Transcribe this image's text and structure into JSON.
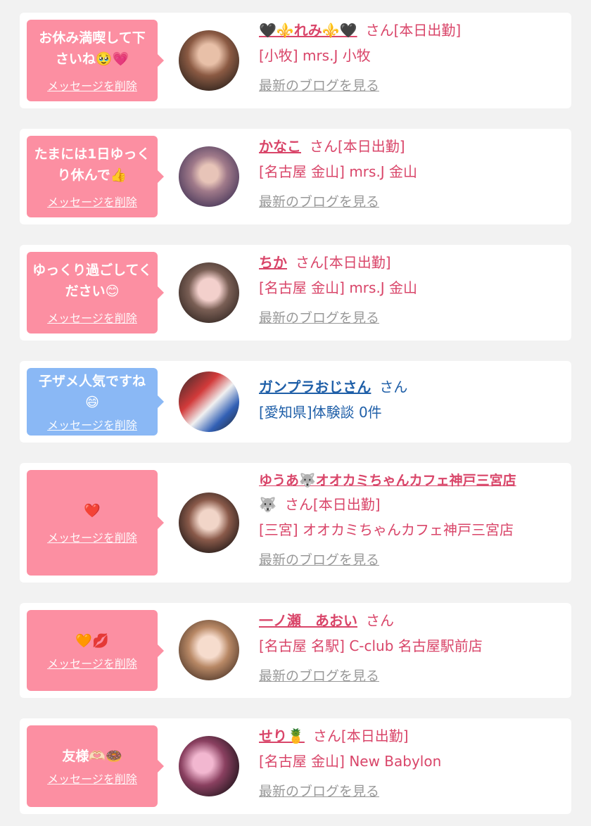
{
  "delete_label": "メッセージを削除",
  "blog_label": "最新のブログを見る",
  "cards": [
    {
      "message": "お休み満喫して下さいね🥹💗",
      "name": "🖤⚜️れみ⚜️🖤",
      "san": "さん[本日出勤]",
      "shop": "[小牧] mrs.J 小牧"
    },
    {
      "message": "たまには1日ゆっくり休んで👍",
      "name": "かなこ",
      "san": "さん[本日出勤]",
      "shop": "[名古屋 金山] mrs.J 金山"
    },
    {
      "message": "ゆっくり過ごしてください😊",
      "name": "ちか",
      "san": "さん[本日出勤]",
      "shop": "[名古屋 金山] mrs.J 金山"
    },
    {
      "message": "子ザメ人気ですね😄",
      "name": "ガンプラおじさん",
      "san": "さん",
      "shop": "[愛知県]体験談 0件"
    },
    {
      "message": "❤️",
      "name": "ゆうあ🐺オオカミちゃんカフェ神戸三宮店",
      "name_cont": "🐺",
      "san": "さん[本日出勤]",
      "shop": "[三宮] オオカミちゃんカフェ神戸三宮店"
    },
    {
      "message": "🧡💋",
      "name": "一ノ瀬　あおい",
      "san": "さん",
      "shop": "[名古屋 名駅] C-club 名古屋駅前店"
    },
    {
      "message": "友様🫶🏻🍩",
      "name": "せり🍍",
      "san": "さん[本日出勤]",
      "shop": "[名古屋 金山] New Babylon"
    }
  ]
}
